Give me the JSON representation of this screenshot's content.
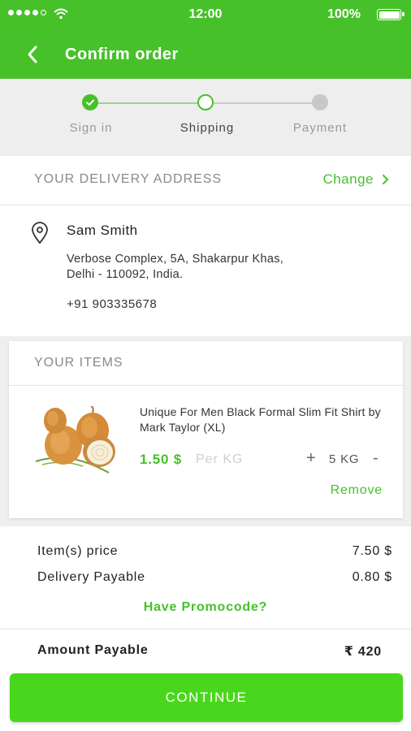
{
  "status_bar": {
    "time": "12:00",
    "battery": "100%"
  },
  "header": {
    "title": "Confirm order",
    "back_icon": "chevron-left-icon"
  },
  "steps": [
    {
      "label": "Sign in",
      "state": "done"
    },
    {
      "label": "Shipping",
      "state": "current"
    },
    {
      "label": "Payment",
      "state": "todo"
    }
  ],
  "address": {
    "section_title": "YOUR DELIVERY ADDRESS",
    "change_label": "Change",
    "name": "Sam Smith",
    "line1": "Verbose Complex, 5A, Shakarpur Khas,",
    "line2": "Delhi - 110092, India.",
    "phone": "+91 903335678"
  },
  "items": {
    "section_title": "YOUR ITEMS",
    "list": [
      {
        "name": "Unique For Men Black Formal Slim Fit Shirt by Mark Taylor (XL)",
        "price": "1.50 $",
        "unit": "Per KG",
        "quantity": "5 KG",
        "plus": "+",
        "minus": "-",
        "remove_label": "Remove"
      }
    ]
  },
  "summary": {
    "item_price_label": "Item(s) price",
    "item_price_value": "7.50 $",
    "delivery_label": "Delivery Payable",
    "delivery_value": "0.80 $",
    "promo_label": "Have Promocode?",
    "amount_label": "Amount Payable",
    "amount_value": "₹ 420"
  },
  "continue_label": "CONTINUE",
  "colors": {
    "brand_green": "#47c12a",
    "button_green": "#48d71c"
  }
}
